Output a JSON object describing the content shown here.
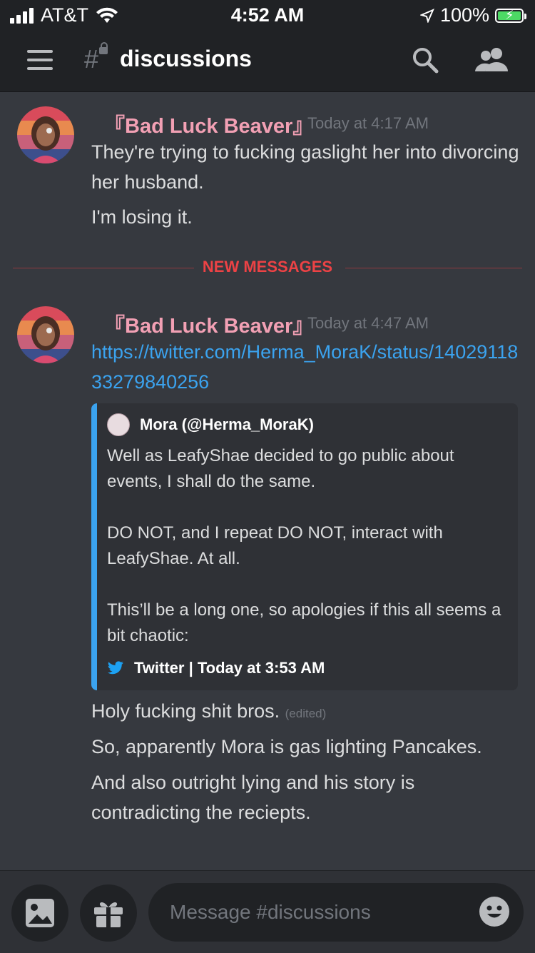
{
  "status_bar": {
    "carrier": "AT&T",
    "time": "4:52 AM",
    "battery": "100%"
  },
  "header": {
    "channel": "discussions"
  },
  "messages": [
    {
      "author": "『Bad Luck Beaver』",
      "timestamp": "Today at 4:17 AM",
      "lines": [
        "They're trying to fucking gaslight her into divorcing her husband.",
        "I'm losing it."
      ]
    },
    {
      "author": "『Bad Luck Beaver』",
      "timestamp": "Today at 4:47 AM",
      "link": "https://twitter.com/Herma_MoraK/status/1402911833279840256",
      "embed": {
        "author": "Mora (@Herma_MoraK)",
        "description": "Well as LeafyShae decided to go public about events, I shall do the same.\n\nDO NOT, and I repeat DO NOT, interact with LeafyShae. At all.\n\nThis’ll be a long one, so apologies if this all seems a bit chaotic:",
        "footer": "Twitter | Today at 3:53 AM",
        "accent_color": "#3ba3ef"
      },
      "lines": [
        "Holy fucking shit bros.",
        "So, apparently Mora is gas lighting Pancakes.",
        "And also outright lying and his story is contradicting the reciepts."
      ],
      "edited_label": "(edited)"
    }
  ],
  "divider_label": "NEW MESSAGES",
  "composer": {
    "placeholder": "Message #discussions"
  },
  "colors": {
    "background": "#36393f",
    "header": "#202225",
    "author": "#f2a0b4",
    "link": "#3ba3ef",
    "new_messages": "#ed4245"
  },
  "icons": [
    "hamburger-icon",
    "channel-hash-lock-icon",
    "search-icon",
    "members-icon",
    "image-icon",
    "gift-icon",
    "emoji-icon",
    "twitter-icon"
  ]
}
